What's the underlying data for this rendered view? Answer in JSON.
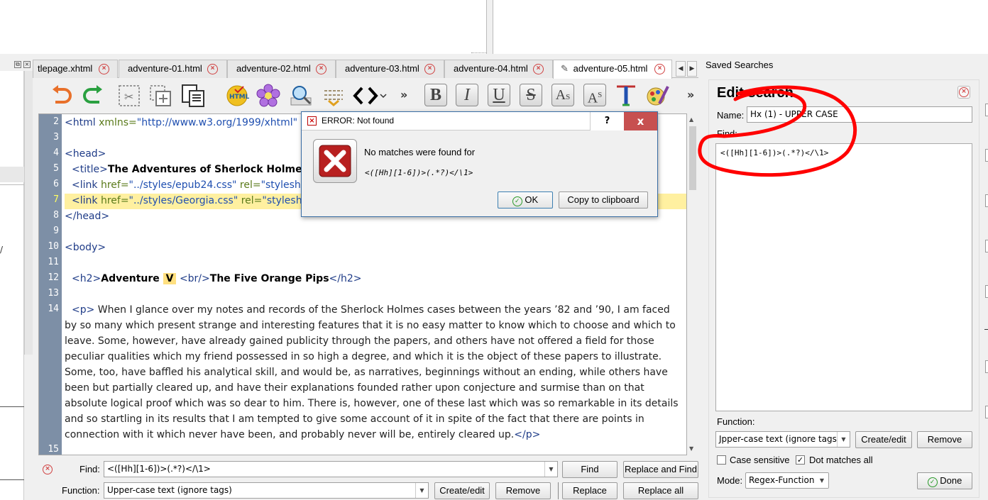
{
  "tabs": [
    {
      "label": "tlepage.xhtml"
    },
    {
      "label": "adventure-01.html"
    },
    {
      "label": "adventure-02.html"
    },
    {
      "label": "adventure-03.html"
    },
    {
      "label": "adventure-04.html"
    },
    {
      "label": "adventure-05.html",
      "active": true
    }
  ],
  "editor": {
    "current_line": 7,
    "line_numbers": [
      "2",
      "3",
      "4",
      "5",
      "6",
      "7",
      "8",
      "9",
      "10",
      "11",
      "12",
      "13",
      "14",
      "15"
    ],
    "line2": {
      "tag_open": "<html ",
      "attr": "xmlns=",
      "val": "\"http://www.w3.org/1999/xhtml\""
    },
    "line4": "<head>",
    "line5": {
      "tag_open": "<title>",
      "text": "The Adventures of Sherlock Holmes",
      "tag_close": "<"
    },
    "line6": {
      "tag_open": "<link ",
      "attr": "href=",
      "val": "\"../styles/epub24.css\"",
      "attr2": " rel=",
      "val2": "\"styleshe"
    },
    "line7": {
      "tag_open": "<link ",
      "attr": "href=",
      "val": "\"../styles/Georgia.css\"",
      "attr2": " rel=",
      "val2": "\"styleshe"
    },
    "line8": "</head>",
    "line10": "<body>",
    "line12": {
      "tag_open": "<h2>",
      "text1": "Adventure ",
      "highlight": "V",
      "br": "<br/>",
      "text2": "The Five Orange Pips",
      "tag_close": "</h2>"
    },
    "line14": {
      "tag_open": "<p>",
      "text": " When I glance over my notes and records of the Sherlock Holmes cases between the years ’82 and ’90, I am faced by so many which present strange and interesting features that it is no easy matter to know which to choose and which to leave. Some, however, have already gained publicity through the papers, and others have not offered a field for those peculiar qualities which my friend possessed in so high a degree, and which it is the object of these papers to illustrate. Some, too, have baffled his analytical skill, and would be, as narratives, beginnings without an ending, while others have been but partially cleared up, and have their explanations founded rather upon conjecture and surmise than on that absolute logical proof which was so dear to him. There is, however, one of these last which was so remarkable in its details and so startling in its results that I am tempted to give some account of it in spite of the fact that there are points in connection with it which never have been, and probably never will be, entirely cleared up.",
      "tag_close": "</p>"
    }
  },
  "findbar": {
    "find_label": "Find:",
    "find_value": "<([Hh][1-6])>(.*?)</\\1>",
    "function_label": "Function:",
    "function_value": "Upper-case text (ignore tags)",
    "find_btn": "Find",
    "replace_and_find_btn": "Replace and Find",
    "create_edit_btn": "Create/edit",
    "remove_btn": "Remove",
    "replace_btn": "Replace",
    "replace_all_btn": "Replace all"
  },
  "saved_searches": {
    "label": "Saved Searches",
    "title": "Edit search",
    "name_label": "Name:",
    "name_value": "Hx (1) - UPPER CASE",
    "find_label": "Find:",
    "find_value": "<([Hh][1-6])>(.*?)</\\1>",
    "function_label": "Function:",
    "function_value": "Jpper-case text (ignore tags)",
    "create_edit_btn": "Create/edit",
    "remove_btn": "Remove",
    "case_sensitive_label": "Case sensitive",
    "case_sensitive_checked": false,
    "dot_matches_all_label": "Dot matches all",
    "dot_matches_all_checked": true,
    "mode_label": "Mode:",
    "mode_value": "Regex-Function",
    "done_btn": "Done",
    "annotation_color": "#ff0000"
  },
  "dialog": {
    "title": "ERROR: Not found",
    "help": "?",
    "close": "x",
    "message": "No matches were found for",
    "pattern": "<([Hh][1-6])>(.*?)</\\1>",
    "ok_btn": "OK",
    "copy_btn": "Copy to clipboard"
  },
  "colors": {
    "gutter": "#7d8fa6",
    "current_line": "#fff0a0",
    "dialog_close": "#c75050",
    "tab_close": "#d04040"
  }
}
